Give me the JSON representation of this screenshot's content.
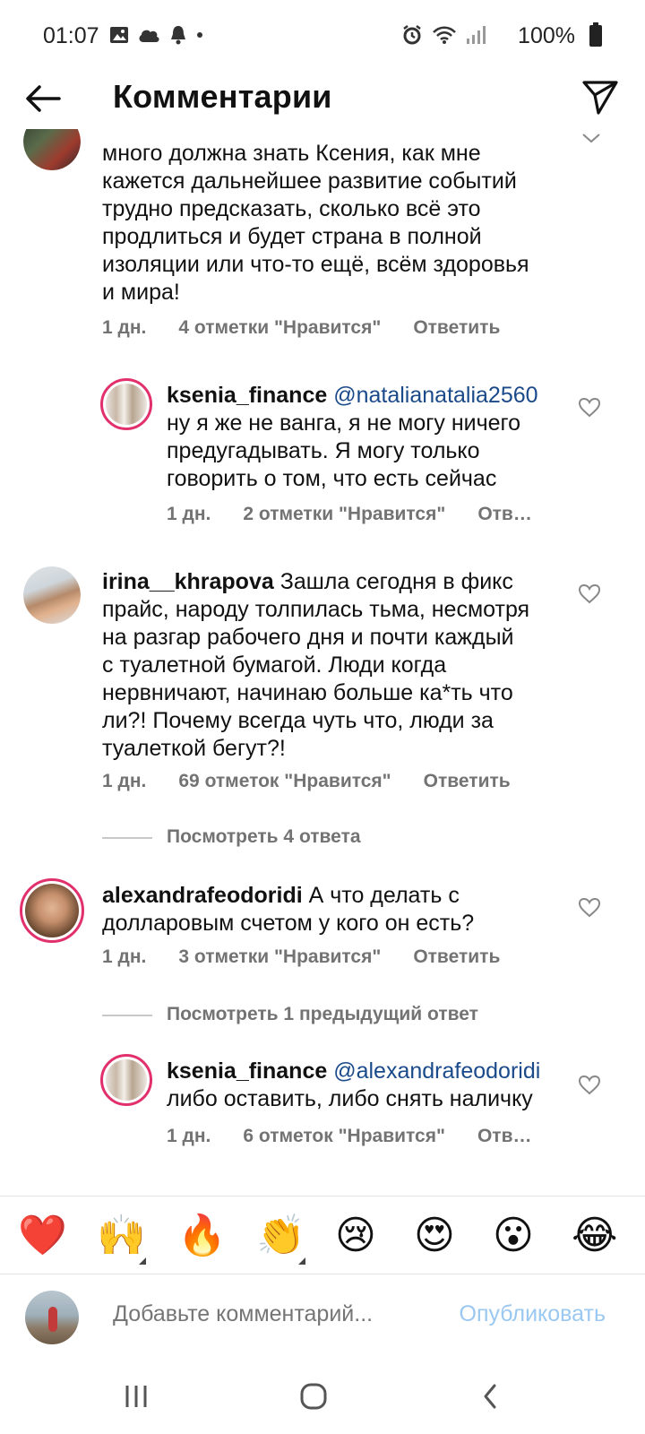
{
  "status_bar": {
    "time": "01:07",
    "battery": "100%",
    "icons": [
      "image-icon",
      "cloud-icon",
      "bell-icon",
      "dot-icon",
      "alarm-icon",
      "wifi-icon",
      "signal-icon",
      "battery-icon"
    ]
  },
  "header": {
    "title": "Комментарии",
    "back_icon": "arrow-left-icon",
    "share_icon": "paper-plane-icon"
  },
  "comments": [
    {
      "lines": [
        "много должна знать Ксения, как мне",
        "кажется дальнейшее развитие событий",
        "трудно предсказать, сколько всё это",
        "продлиться и будет страна в полной",
        "изоляции или что-то ещё, всём здоровья",
        "и мира!"
      ],
      "time": "1 дн.",
      "likes": "4 отметки \"Нравится\"",
      "reply": "Ответить"
    },
    {
      "user": "ksenia_finance",
      "mention": "@natalianatalia2560",
      "lines": [
        "ну я же не ванга, я не могу ничего",
        "предугадывать. Я могу только",
        "говорить о том, что есть сейчас"
      ],
      "time": "1 дн.",
      "likes": "2 отметки \"Нравится\"",
      "reply": "Отв…"
    },
    {
      "user": "irina__khrapova",
      "first_line": "Зашла сегодня в фикс",
      "lines": [
        "прайс, народу толпилась тьма, несмотря",
        "на разгар рабочего дня и почти каждый",
        "с туалетной бумагой. Люди когда",
        "нервничают, начинаю больше ка*ть что",
        "ли?! Почему всегда чуть что, люди за",
        "туалеткой бегут?!"
      ],
      "time": "1 дн.",
      "likes": "69 отметок \"Нравится\"",
      "reply": "Ответить",
      "view_replies": "Посмотреть 4 ответа"
    },
    {
      "user": "alexandrafeodoridi",
      "first_line": "А что делать с",
      "lines": [
        "долларовым счетом у кого он есть?"
      ],
      "time": "1 дн.",
      "likes": "3 отметки \"Нравится\"",
      "reply": "Ответить",
      "view_replies": "Посмотреть 1 предыдущий ответ"
    },
    {
      "user": "ksenia_finance",
      "mention": "@alexandrafeodoridi",
      "lines": [
        "либо оставить, либо снять наличку"
      ],
      "time": "1 дн.",
      "likes": "6 отметок \"Нравится\"",
      "reply": "Отв…"
    }
  ],
  "reactions": [
    "❤️",
    "🙌",
    "🔥",
    "👏",
    "😢",
    "😍",
    "😮",
    "😂"
  ],
  "composer": {
    "placeholder": "Добавьте комментарий...",
    "post_label": "Опубликовать"
  },
  "nav": [
    "recent-apps-icon",
    "home-icon",
    "back-icon"
  ]
}
